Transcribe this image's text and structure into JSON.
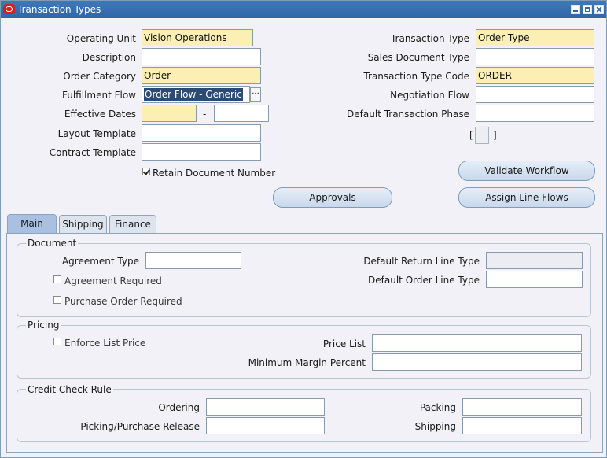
{
  "window": {
    "title": "Transaction Types"
  },
  "header": {
    "operating_unit": {
      "label": "Operating Unit",
      "value": "Vision Operations"
    },
    "description": {
      "label": "Description",
      "value": ""
    },
    "order_category": {
      "label": "Order Category",
      "value": "Order"
    },
    "fulfillment_flow": {
      "label": "Fulfillment Flow",
      "value": "Order Flow - Generic",
      "lov": "..."
    },
    "effective_dates": {
      "label": "Effective Dates",
      "from": "",
      "separator": "-",
      "to": ""
    },
    "layout_template": {
      "label": "Layout Template",
      "value": ""
    },
    "contract_template": {
      "label": "Contract Template",
      "value": ""
    },
    "retain_document_number": {
      "label": "Retain Document Number",
      "checked": true
    },
    "transaction_type": {
      "label": "Transaction Type",
      "value": "Order Type"
    },
    "sales_document_type": {
      "label": "Sales Document Type",
      "value": ""
    },
    "transaction_type_code": {
      "label": "Transaction Type Code",
      "value": "ORDER"
    },
    "negotiation_flow": {
      "label": "Negotiation Flow",
      "value": ""
    },
    "default_transaction_phase": {
      "label": "Default Transaction Phase",
      "value": ""
    },
    "flex_open": "[",
    "flex_close": "]"
  },
  "buttons": {
    "validate_workflow": "Validate Workflow",
    "approvals": "Approvals",
    "assign_line_flows": "Assign Line  Flows"
  },
  "tabs": [
    {
      "label": "Main",
      "active": true
    },
    {
      "label": "Shipping",
      "active": false
    },
    {
      "label": "Finance",
      "active": false
    }
  ],
  "main": {
    "document": {
      "title": "Document",
      "agreement_type": {
        "label": "Agreement Type",
        "value": ""
      },
      "agreement_required": {
        "label": "Agreement Required",
        "checked": false
      },
      "purchase_order_required": {
        "label": "Purchase Order Required",
        "checked": false
      },
      "default_return_line_type": {
        "label": "Default Return Line Type",
        "value": ""
      },
      "default_order_line_type": {
        "label": "Default Order Line Type",
        "value": ""
      }
    },
    "pricing": {
      "title": "Pricing",
      "enforce_list_price": {
        "label": "Enforce List Price",
        "checked": false
      },
      "price_list": {
        "label": "Price List",
        "value": ""
      },
      "minimum_margin_percent": {
        "label": "Minimum Margin Percent",
        "value": ""
      }
    },
    "credit_check_rule": {
      "title": "Credit Check Rule",
      "ordering": {
        "label": "Ordering",
        "value": ""
      },
      "picking_purchase_release": {
        "label": "Picking/Purchase Release",
        "value": ""
      },
      "packing": {
        "label": "Packing",
        "value": ""
      },
      "shipping": {
        "label": "Shipping",
        "value": ""
      }
    }
  },
  "colors": {
    "title_bar": "#2f66a8",
    "required_field": "#fcefb4",
    "selection": "#2c4a74",
    "active_tab": "#a9c0e0",
    "window_bg": "#f1f1f7"
  }
}
